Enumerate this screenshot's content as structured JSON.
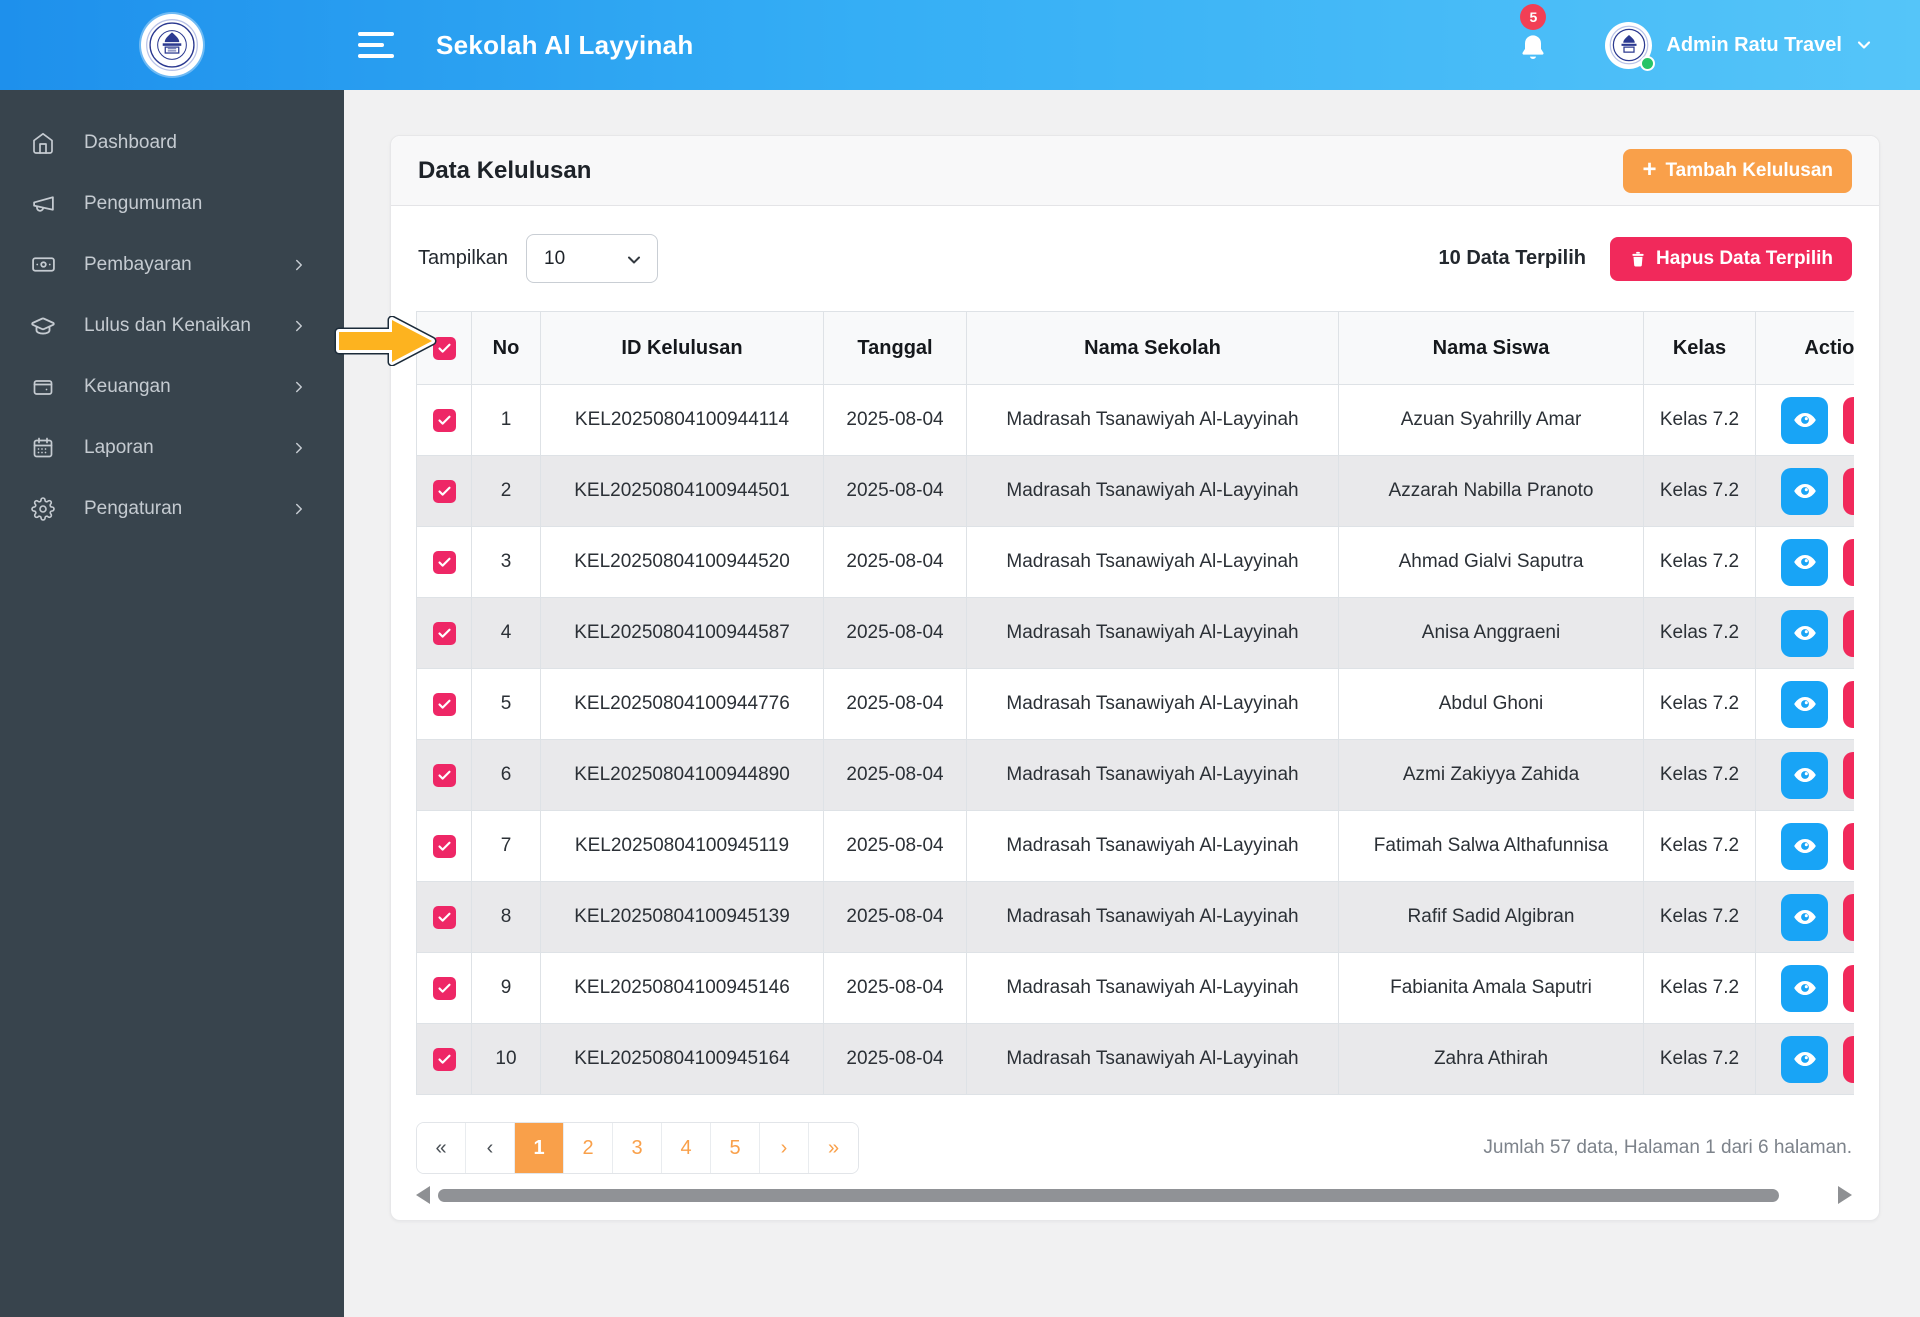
{
  "header": {
    "title": "Sekolah Al Layyinah",
    "notification_count": "5",
    "user_name": "Admin Ratu Travel"
  },
  "sidebar": {
    "items": [
      {
        "label": "Dashboard",
        "icon": "home-icon",
        "has_submenu": false
      },
      {
        "label": "Pengumuman",
        "icon": "megaphone-icon",
        "has_submenu": false
      },
      {
        "label": "Pembayaran",
        "icon": "banknote-icon",
        "has_submenu": true
      },
      {
        "label": "Lulus dan Kenaikan",
        "icon": "graduation-cap-icon",
        "has_submenu": true
      },
      {
        "label": "Keuangan",
        "icon": "wallet-icon",
        "has_submenu": true
      },
      {
        "label": "Laporan",
        "icon": "calendar-icon",
        "has_submenu": true
      },
      {
        "label": "Pengaturan",
        "icon": "gear-icon",
        "has_submenu": true
      }
    ]
  },
  "page": {
    "card_title": "Data Kelulusan",
    "add_button_label": "Tambah Kelulusan",
    "show_label": "Tampilkan",
    "page_size": "10",
    "selected_info": "10 Data Terpilih",
    "delete_button_label": "Hapus Data Terpilih",
    "table": {
      "columns": [
        "No",
        "ID Kelulusan",
        "Tanggal",
        "Nama Sekolah",
        "Nama Siswa",
        "Kelas",
        "Action"
      ],
      "rows": [
        {
          "no": "1",
          "id": "KEL20250804100944114",
          "tanggal": "2025-08-04",
          "sekolah": "Madrasah Tsanawiyah Al-Layyinah",
          "siswa": "Azuan Syahrilly Amar",
          "kelas": "Kelas 7.2"
        },
        {
          "no": "2",
          "id": "KEL20250804100944501",
          "tanggal": "2025-08-04",
          "sekolah": "Madrasah Tsanawiyah Al-Layyinah",
          "siswa": "Azzarah Nabilla Pranoto",
          "kelas": "Kelas 7.2"
        },
        {
          "no": "3",
          "id": "KEL20250804100944520",
          "tanggal": "2025-08-04",
          "sekolah": "Madrasah Tsanawiyah Al-Layyinah",
          "siswa": "Ahmad Gialvi Saputra",
          "kelas": "Kelas 7.2"
        },
        {
          "no": "4",
          "id": "KEL20250804100944587",
          "tanggal": "2025-08-04",
          "sekolah": "Madrasah Tsanawiyah Al-Layyinah",
          "siswa": "Anisa Anggraeni",
          "kelas": "Kelas 7.2"
        },
        {
          "no": "5",
          "id": "KEL20250804100944776",
          "tanggal": "2025-08-04",
          "sekolah": "Madrasah Tsanawiyah Al-Layyinah",
          "siswa": "Abdul Ghoni",
          "kelas": "Kelas 7.2"
        },
        {
          "no": "6",
          "id": "KEL20250804100944890",
          "tanggal": "2025-08-04",
          "sekolah": "Madrasah Tsanawiyah Al-Layyinah",
          "siswa": "Azmi Zakiyya Zahida",
          "kelas": "Kelas 7.2"
        },
        {
          "no": "7",
          "id": "KEL20250804100945119",
          "tanggal": "2025-08-04",
          "sekolah": "Madrasah Tsanawiyah Al-Layyinah",
          "siswa": "Fatimah Salwa Althafunnisa",
          "kelas": "Kelas 7.2"
        },
        {
          "no": "8",
          "id": "KEL20250804100945139",
          "tanggal": "2025-08-04",
          "sekolah": "Madrasah Tsanawiyah Al-Layyinah",
          "siswa": "Rafif Sadid Algibran",
          "kelas": "Kelas 7.2"
        },
        {
          "no": "9",
          "id": "KEL20250804100945146",
          "tanggal": "2025-08-04",
          "sekolah": "Madrasah Tsanawiyah Al-Layyinah",
          "siswa": "Fabianita Amala Saputri",
          "kelas": "Kelas 7.2"
        },
        {
          "no": "10",
          "id": "KEL20250804100945164",
          "tanggal": "2025-08-04",
          "sekolah": "Madrasah Tsanawiyah Al-Layyinah",
          "siswa": "Zahra Athirah",
          "kelas": "Kelas 7.2"
        }
      ]
    },
    "pagination": {
      "items": [
        {
          "label": "«",
          "style_class": "nav-dark"
        },
        {
          "label": "‹",
          "style_class": "nav-dark"
        },
        {
          "label": "1",
          "style_class": "active"
        },
        {
          "label": "2"
        },
        {
          "label": "3"
        },
        {
          "label": "4"
        },
        {
          "label": "5"
        },
        {
          "label": "›"
        },
        {
          "label": "»"
        }
      ],
      "summary": "Jumlah 57 data, Halaman 1 dari 6 halaman."
    }
  },
  "colors": {
    "header_gradient_start": "#1e90ec",
    "header_gradient_end": "#55c5f9",
    "sidebar_bg": "#38444d",
    "accent_orange": "#f9a04a",
    "accent_red": "#f1295b",
    "accent_blue": "#18a4f6",
    "checkbox_pink": "#ee2766",
    "badge_red": "#f23f55",
    "status_green": "#27c468",
    "row_stripe": "#e9e9eb"
  }
}
